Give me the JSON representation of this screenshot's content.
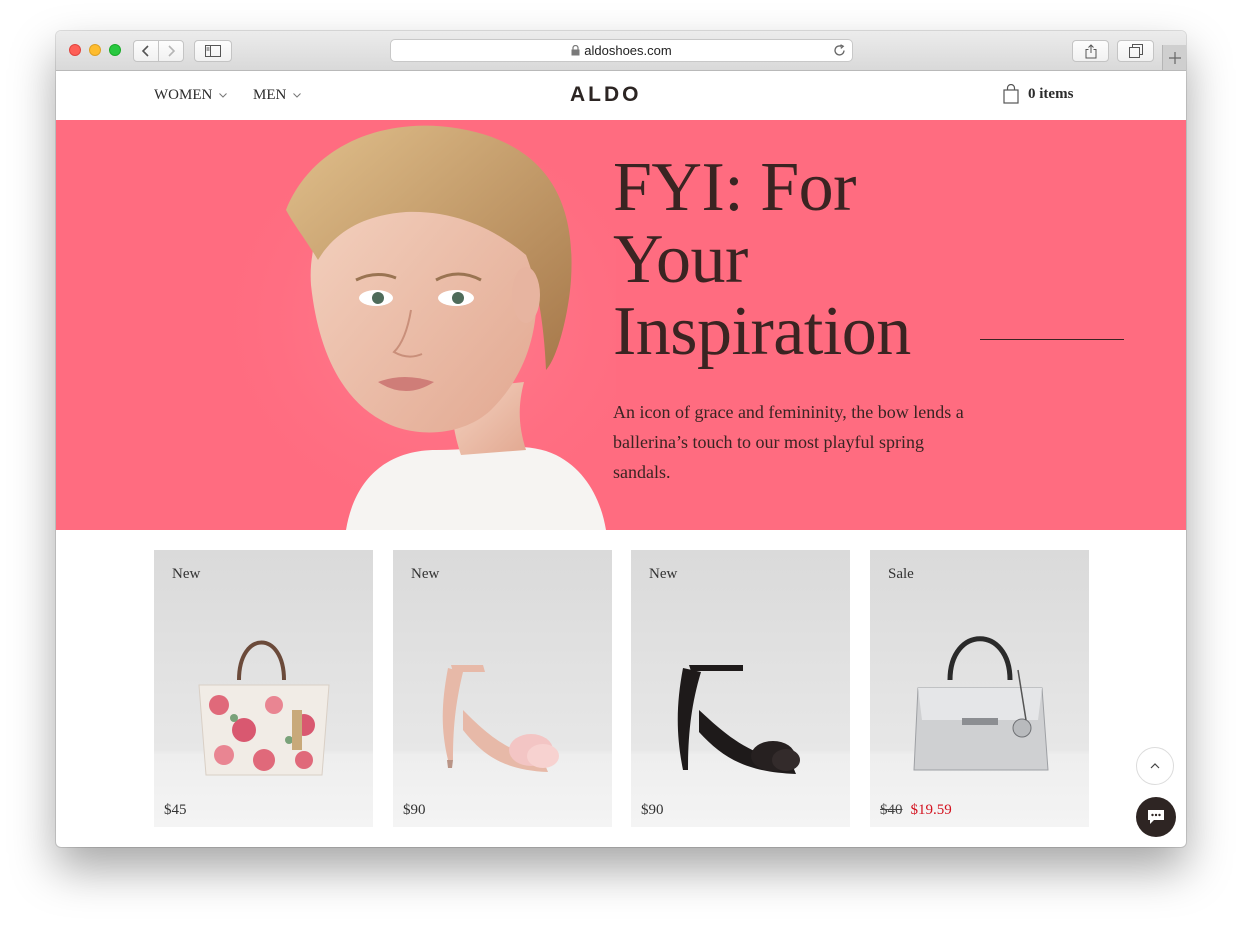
{
  "browser": {
    "url": "aldoshoes.com",
    "icons": [
      "back-icon",
      "forward-icon",
      "sidebar-icon",
      "lock-icon",
      "reload-icon",
      "share-icon",
      "tabs-icon",
      "plus-icon"
    ]
  },
  "header": {
    "nav": [
      {
        "label": "WOMEN"
      },
      {
        "label": "MEN"
      }
    ],
    "logo": "ALDO",
    "cart_label": "0 items"
  },
  "hero": {
    "title": "FYI: For Your Inspiration",
    "text": "An icon of grace and femininity, the bow lends a ballerina’s touch to our most playful spring sandals.",
    "background_color": "#ff6c80"
  },
  "products": [
    {
      "badge": "New",
      "price": "$45",
      "kind": "floral tote bag"
    },
    {
      "badge": "New",
      "price": "$90",
      "kind": "pink fur heel sandal"
    },
    {
      "badge": "New",
      "price": "$90",
      "kind": "black fur heel sandal"
    },
    {
      "badge": "Sale",
      "old_price": "$40",
      "price": "$19.59",
      "kind": "silver handbag"
    }
  ],
  "colors": {
    "text_dark": "#3a2422",
    "sale_red": "#d3121f",
    "chat_button": "#2e2523"
  }
}
